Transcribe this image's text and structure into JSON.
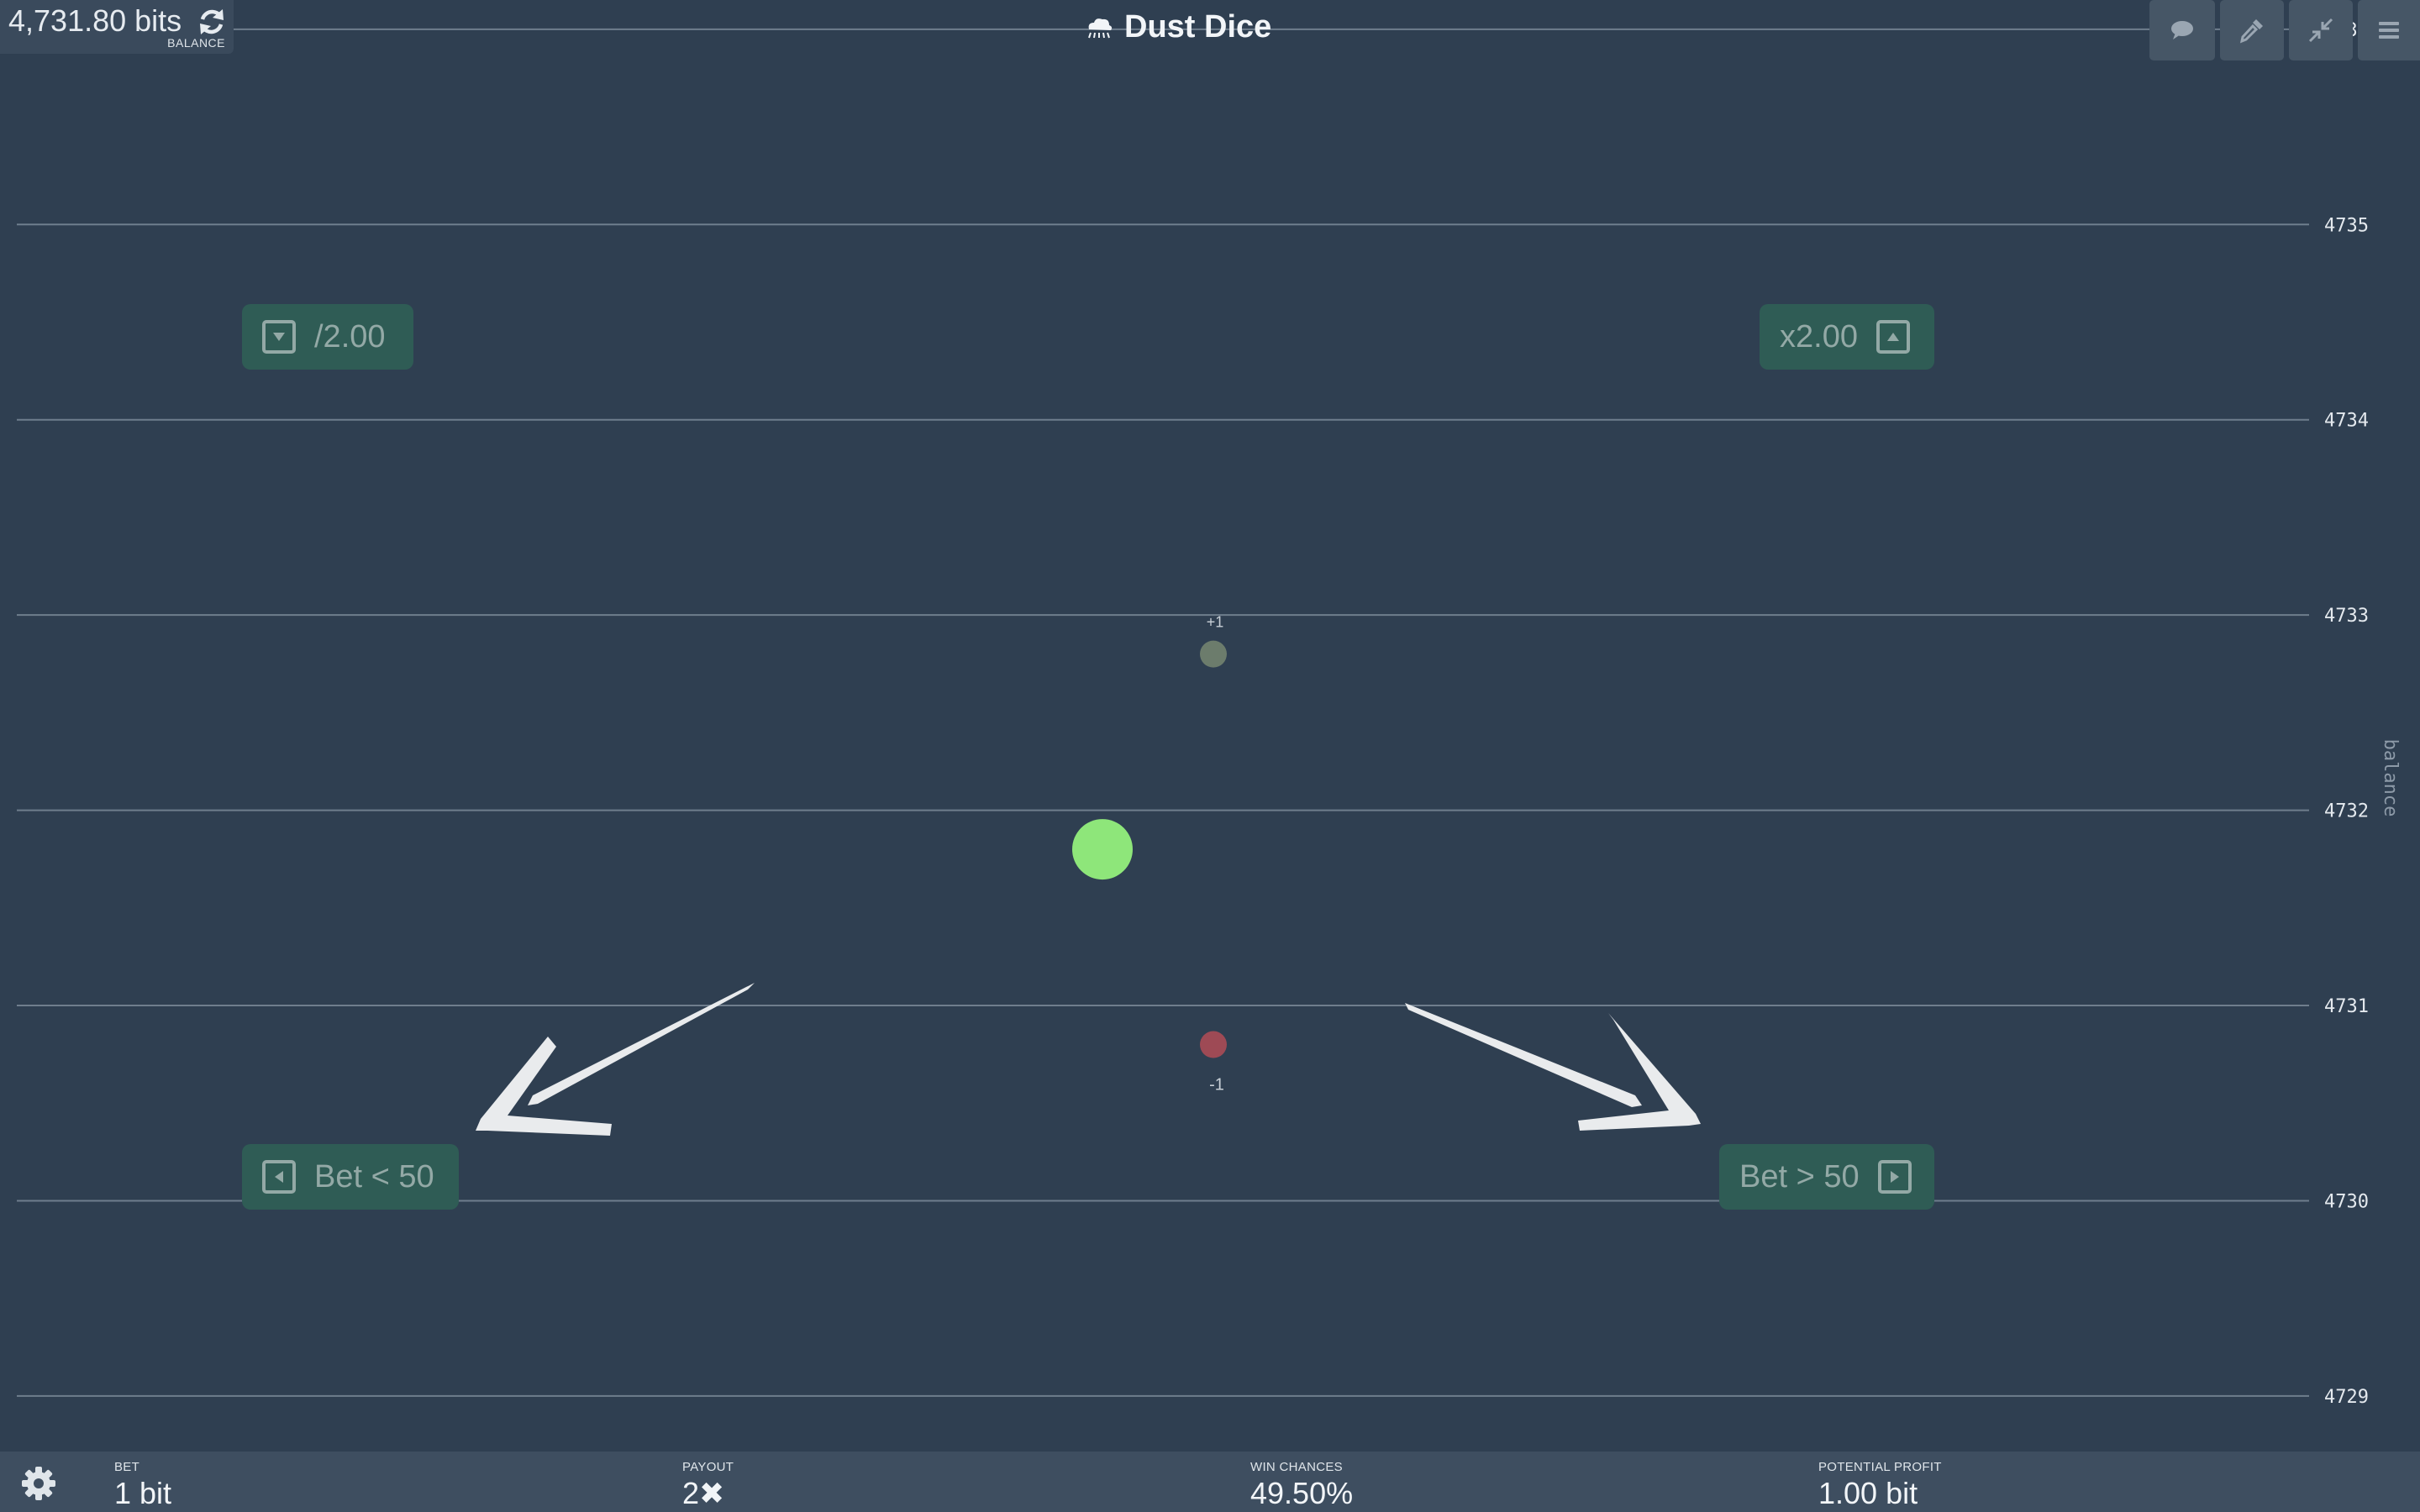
{
  "balance": {
    "amount": "4,731.80 bits",
    "caption": "BALANCE",
    "refresh_icon": "refresh-icon"
  },
  "app": {
    "title": "Dust Dice",
    "logo_icon": "dust-cloud-icon"
  },
  "toolbar": {
    "icons": [
      "chat-icon",
      "eyedropper-icon",
      "compress-icon",
      "menu-icon"
    ]
  },
  "controls": {
    "halve_bet": {
      "label": "/2.00",
      "icon": "arrow-down-icon"
    },
    "double_bet": {
      "label": "x2.00",
      "icon": "arrow-up-icon"
    },
    "bet_low": {
      "label": "Bet < 50",
      "icon": "arrow-left-icon"
    },
    "bet_high": {
      "label": "Bet > 50",
      "icon": "arrow-right-icon"
    }
  },
  "chart_data": {
    "type": "scatter",
    "ylabel": "balance",
    "ylim": [
      4728.75,
      4736.15
    ],
    "yticks": [
      4736,
      4735,
      4734,
      4733,
      4732,
      4731,
      4730,
      4729
    ],
    "grid": true,
    "points": [
      {
        "role": "current",
        "y": 4731.8,
        "color": "#8ee67a"
      },
      {
        "role": "win-preview",
        "y": 4732.8,
        "label": "+1",
        "color": "#6c7c6c"
      },
      {
        "role": "loss-preview",
        "y": 4730.8,
        "label": "-1",
        "color": "#9e4a55"
      }
    ]
  },
  "footer": {
    "settings_icon": "gear-icon",
    "bet": {
      "label": "BET",
      "value": "1 bit"
    },
    "payout": {
      "label": "PAYOUT",
      "value": "2✖"
    },
    "win_chances": {
      "label": "WIN CHANCES",
      "value": "49.50%"
    },
    "potential_profit": {
      "label": "POTENTIAL PROFIT",
      "value": "1.00 bit"
    }
  }
}
